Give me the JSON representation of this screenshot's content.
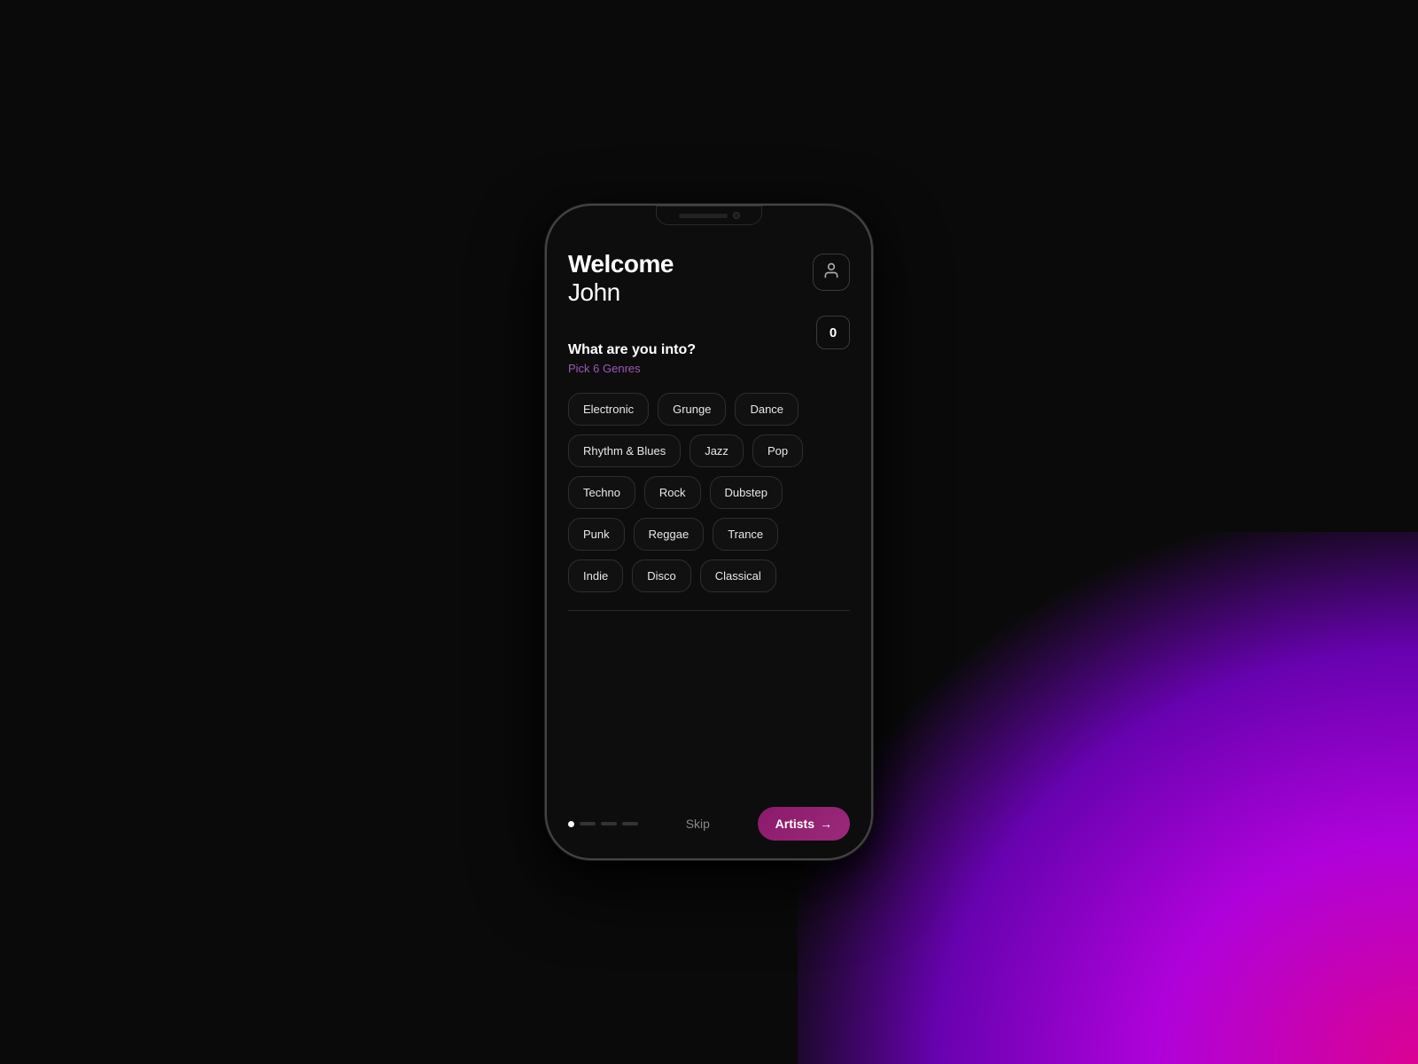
{
  "background": {
    "gradient_description": "radial pink-purple gradient bottom-right"
  },
  "phone": {
    "notch": {
      "has_speaker": true,
      "has_camera": true
    }
  },
  "screen": {
    "header": {
      "welcome_label": "Welcome",
      "user_name": "John",
      "profile_icon": "👤"
    },
    "section": {
      "question": "What are you into?",
      "subtitle": "Pick 6 Genres",
      "counter": "0"
    },
    "genres": [
      [
        "Electronic",
        "Grunge",
        "Dance"
      ],
      [
        "Rhythm & Blues",
        "Jazz",
        "Pop"
      ],
      [
        "Techno",
        "Rock",
        "Dubstep"
      ],
      [
        "Punk",
        "Reggae",
        "Trance"
      ],
      [
        "Indie",
        "Disco",
        "Classical"
      ]
    ],
    "bottom_nav": {
      "skip_label": "Skip",
      "artists_label": "Artists",
      "arrow": "→",
      "dots": [
        {
          "type": "active"
        },
        {
          "type": "dash"
        },
        {
          "type": "dash"
        },
        {
          "type": "dash"
        }
      ]
    }
  }
}
